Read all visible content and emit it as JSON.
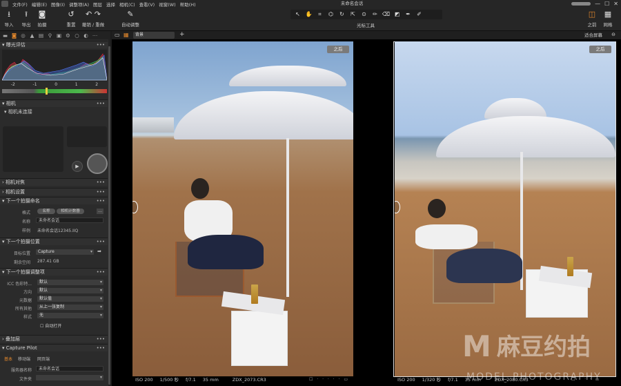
{
  "menu": [
    "文件(F)",
    "编辑(E)",
    "图像(I)",
    "调整项(A)",
    "图层",
    "选择",
    "相机(C)",
    "查看(V)",
    "视窗(W)",
    "帮助(H)"
  ],
  "window_title": "未命名会话",
  "toolbar": {
    "import": "导入",
    "export": "导出",
    "capture": "拍摄",
    "reset": "重置",
    "undo_redo": "撤销 / 重做",
    "auto_adjust": "自动调整",
    "cursor_tools": "光标工具",
    "before": "之前",
    "grid": "网格"
  },
  "viewer": {
    "variant": "背景",
    "fit": "适合屏幕"
  },
  "left": {
    "exposure": "曝光评估",
    "scale": [
      "-2",
      "-1",
      "0",
      "1",
      "2"
    ],
    "camera": "相机",
    "camera_status": "相机未连接",
    "focus": "相机对焦",
    "settings": "相机设置",
    "naming": "下一个拍摄命名",
    "format_lbl": "格式",
    "format_tags": [
      "名称",
      "相机计数器"
    ],
    "name_lbl": "名称",
    "name_val": "未命名会话",
    "sample_lbl": "样例",
    "sample_val": "未命名会话12345.IIQ",
    "location": "下一个拍摄位置",
    "dest_lbl": "目标位置",
    "dest_val": "Capture",
    "space_lbl": "剩余空间",
    "space_val": "287.41 GB",
    "adjust": "下一个拍摄调整项",
    "adj_rows": [
      {
        "l": "ICC 色彩特...",
        "v": "默认"
      },
      {
        "l": "方向",
        "v": "默认"
      },
      {
        "l": "元数据",
        "v": "默认值"
      },
      {
        "l": "所有其他",
        "v": "从上一张复制"
      },
      {
        "l": "样式",
        "v": "无"
      }
    ],
    "autoopen": "自动打开",
    "overlay": "叠加层",
    "pilot": "Capture Pilot",
    "pilot_tabs": [
      "基本",
      "移动端",
      "网页端"
    ],
    "server_lbl": "服务器名称",
    "server_val": "未命名会话",
    "folder_lbl": "文件夹"
  },
  "left_image": {
    "badge": "之后",
    "iso": "ISO 200",
    "shutter": "1/500 秒",
    "aperture": "f/7.1",
    "focal": "35 mm",
    "file": "ZDX_2073.CR3"
  },
  "right_image": {
    "badge": "之后",
    "iso": "ISO 200",
    "shutter": "1/320 秒",
    "aperture": "f/7.1",
    "focal": "35 mm",
    "file": "ZDX_2080.CR3"
  },
  "watermark": {
    "main": "麻豆约拍",
    "sub": "MODEL PHOTOGRAPHY"
  },
  "colors": {
    "accent": "#e0862c"
  }
}
